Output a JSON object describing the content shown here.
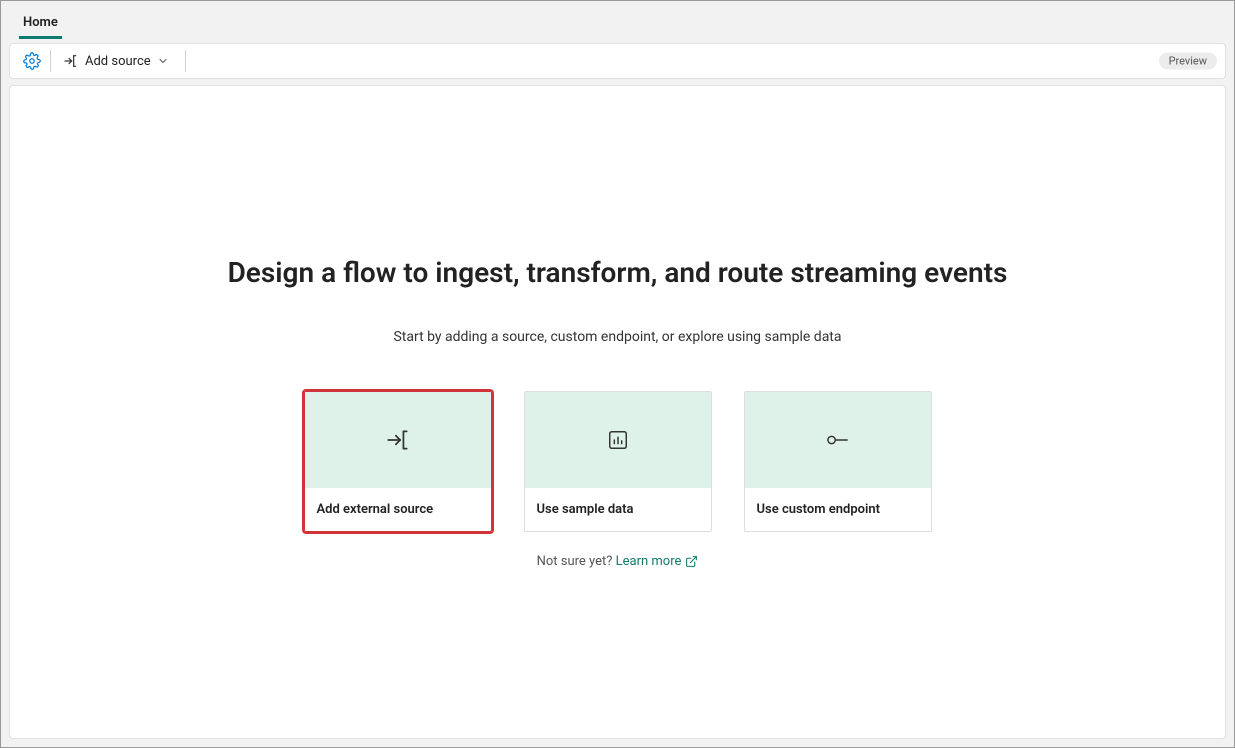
{
  "tabs": {
    "home": "Home"
  },
  "toolbar": {
    "add_source": "Add source",
    "preview_badge": "Preview"
  },
  "hero": {
    "title": "Design a flow to ingest, transform, and route streaming events",
    "subtitle": "Start by adding a source, custom endpoint, or explore using sample data"
  },
  "cards": {
    "external": "Add external source",
    "sample": "Use sample data",
    "endpoint": "Use custom endpoint"
  },
  "footer": {
    "prompt": "Not sure yet? ",
    "learn_more": "Learn more"
  }
}
